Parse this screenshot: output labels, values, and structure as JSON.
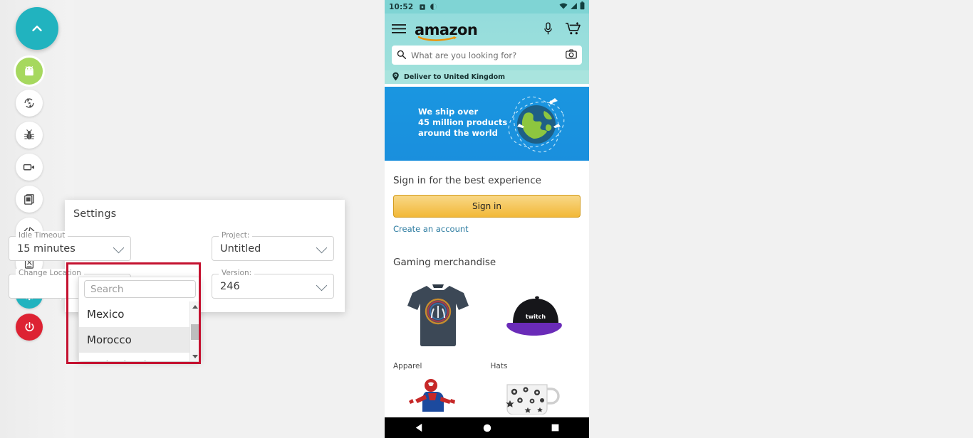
{
  "rail": {
    "buttons": [
      {
        "id": "collapse",
        "icon": "chevron-up-icon",
        "label": "Collapse toolbar"
      },
      {
        "id": "android",
        "icon": "android-icon",
        "label": "Android home"
      },
      {
        "id": "rotate",
        "icon": "rotate-icon",
        "label": "Rotate device"
      },
      {
        "id": "bug",
        "icon": "bug-icon",
        "label": "Bug report"
      },
      {
        "id": "record",
        "icon": "video-camera-icon",
        "label": "Record screen"
      },
      {
        "id": "screens",
        "icon": "screenshot-icon",
        "label": "Screenshots"
      },
      {
        "id": "code",
        "icon": "code-icon",
        "label": "Developer tools"
      },
      {
        "id": "network",
        "icon": "network-icon",
        "label": "Network"
      },
      {
        "id": "settings",
        "icon": "gear-icon",
        "label": "Settings"
      },
      {
        "id": "power",
        "icon": "power-icon",
        "label": "Power off"
      }
    ],
    "accent_teal": "#21b3bf",
    "accent_green": "#a6d85e",
    "accent_red": "#dd2233"
  },
  "settings": {
    "title": "Settings",
    "fields": [
      {
        "legend": "Idle Timeout",
        "value": "15 minutes"
      },
      {
        "legend": "Project:",
        "value": "Untitled"
      },
      {
        "legend": "Change Location",
        "value": ""
      },
      {
        "legend": "Version:",
        "value": "246"
      }
    ],
    "location_dropdown": {
      "search_placeholder": "Search",
      "search_value": "",
      "options": [
        {
          "label": "Mexico",
          "highlighted": false
        },
        {
          "label": "Morocco",
          "highlighted": true
        },
        {
          "label": "Netherlands",
          "highlighted": false
        }
      ]
    },
    "highlight_color": "#c41230"
  },
  "phone": {
    "statusbar": {
      "time": "10:52",
      "left_icons": [
        "sd-card-icon",
        "do-not-disturb-icon"
      ],
      "right_icons": [
        "wifi-icon",
        "signal-icon",
        "battery-icon"
      ]
    },
    "amazon": {
      "menu_icon": "hamburger-menu-icon",
      "logo": "amazon",
      "mic_icon": "microphone-icon",
      "cart_icon": "shopping-cart-icon",
      "search_placeholder": "What are you looking for?",
      "search_icon": "search-icon",
      "camera_icon": "camera-icon",
      "deliver_icon": "location-pin-icon",
      "deliver_text": "Deliver to United Kingdom",
      "banner": {
        "line1": "We ship over",
        "line2": "45 million products",
        "line3": "around the world",
        "art": "globe-with-planes-icon",
        "bg_color": "#1a92de"
      },
      "signin": {
        "title": "Sign in for the best experience",
        "button_label": "Sign in",
        "create_account_label": "Create an account"
      },
      "merchandise": {
        "title": "Gaming merchandise",
        "items": [
          {
            "label": "Apparel",
            "art": "tshirt-image"
          },
          {
            "label": "Hats",
            "art": "cap-image"
          },
          {
            "label": "",
            "art": "spiderman-figure-image"
          },
          {
            "label": "",
            "art": "patterned-mug-image"
          }
        ]
      }
    },
    "navbar": {
      "back_icon": "nav-back-icon",
      "home_icon": "nav-home-icon",
      "recents_icon": "nav-recents-icon"
    }
  }
}
